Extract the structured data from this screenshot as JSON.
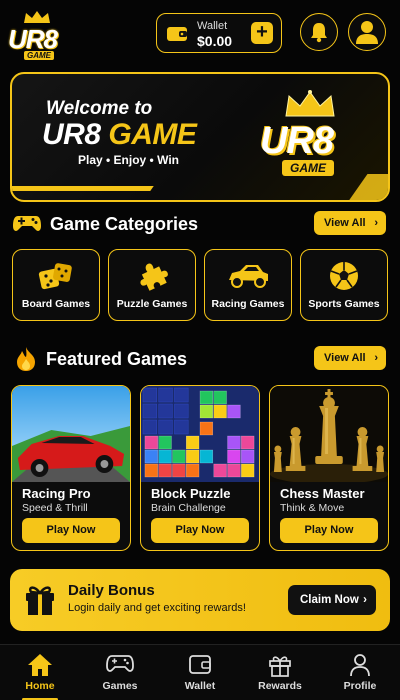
{
  "header": {
    "logo_text": "UR8",
    "logo_sub": "GAME",
    "wallet_label": "Wallet",
    "wallet_value": "$0.00",
    "wallet_add": "+",
    "icons": [
      "wallet-icon",
      "plus-icon",
      "bell-icon",
      "user-icon"
    ]
  },
  "banner": {
    "line1": "Welcome to",
    "line2a": "UR8",
    "line2b": "GAME",
    "tagline": "Play • Enjoy • Win",
    "logo_text": "UR8",
    "logo_sub": "GAME"
  },
  "categories": {
    "title": "Game Categories",
    "view_all": "View All",
    "items": [
      {
        "label": "Board Games",
        "icon": "dice-icon"
      },
      {
        "label": "Puzzle Games",
        "icon": "puzzle-icon"
      },
      {
        "label": "Racing Games",
        "icon": "car-icon"
      },
      {
        "label": "Sports Games",
        "icon": "soccer-ball-icon"
      }
    ]
  },
  "featured": {
    "title": "Featured Games",
    "view_all": "View All",
    "games": [
      {
        "name": "Racing Pro",
        "desc": "Speed & Thrill",
        "button": "Play Now"
      },
      {
        "name": "Block Puzzle",
        "desc": "Brain Challenge",
        "button": "Play Now"
      },
      {
        "name": "Chess Master",
        "desc": "Think & Move",
        "button": "Play Now"
      }
    ]
  },
  "bonus": {
    "title": "Daily Bonus",
    "desc": "Login daily and get exciting rewards!",
    "button": "Claim Now"
  },
  "nav": {
    "items": [
      {
        "label": "Home",
        "icon": "home-icon",
        "active": true
      },
      {
        "label": "Games",
        "icon": "gamepad-icon"
      },
      {
        "label": "Wallet",
        "icon": "wallet-icon"
      },
      {
        "label": "Rewards",
        "icon": "gift-icon"
      },
      {
        "label": "Profile",
        "icon": "user-icon"
      }
    ]
  },
  "colors": {
    "accent": "#f5c518",
    "background": "#050505"
  }
}
